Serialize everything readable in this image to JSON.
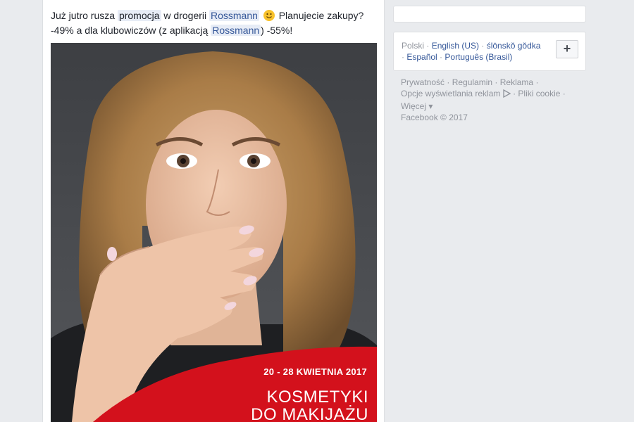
{
  "post": {
    "text_1": "Już jutro rusza ",
    "hashtag_promocja": "promocja",
    "text_2": " w drogerii ",
    "mention_rossmann": "Rossmann",
    "text_3": " Planujecie zakupy?",
    "text_4": "-49% a dla klubowiczów (z aplikacją ",
    "mention_rossmann_2": "Rossmann",
    "text_5": ") -55%!",
    "image": {
      "dates": "20 - 28 KWIETNIA 2017",
      "title_line1": "KOSMETYKI",
      "title_line2": "DO MAKIJAŻU",
      "brand_color": "#d3111c"
    }
  },
  "sidebar": {
    "languages": {
      "current": "Polski",
      "options": [
        "English (US)",
        "ślōnskŏ gŏdka",
        "Español",
        "Português (Brasil)"
      ],
      "add_button": "+"
    },
    "footer": {
      "links": [
        "Prywatność",
        "Regulamin",
        "Reklama",
        "Opcje wyświetlania reklam",
        "Pliki cookie",
        "Więcej"
      ],
      "more_arrow": "▾",
      "copyright": "Facebook © 2017"
    }
  },
  "colors": {
    "page_bg": "#e9ebee",
    "link": "#365899",
    "muted": "#90949c",
    "highlight_bg": "#e7ecf6"
  }
}
